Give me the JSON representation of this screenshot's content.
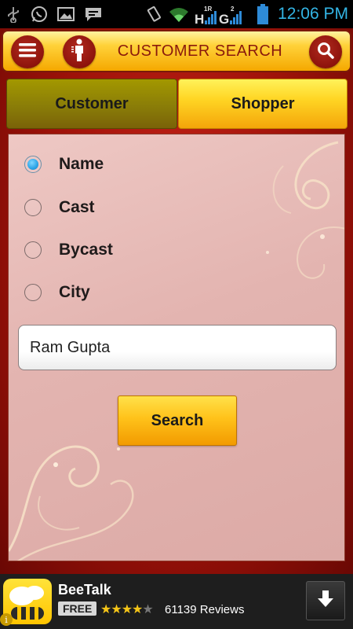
{
  "status_bar": {
    "time": "12:06 PM",
    "signal_labels": [
      "H",
      "1R",
      "G",
      "2"
    ],
    "icons": [
      "usb-icon",
      "whatsapp-icon",
      "gallery-icon",
      "chat-icon",
      "vibrate-icon",
      "wifi-icon",
      "signal-icon",
      "battery-icon"
    ]
  },
  "header": {
    "title": "CUSTOMER SEARCH",
    "menu_icon": "menu-icon",
    "person_icon": "person-icon",
    "search_icon": "search-icon"
  },
  "tabs": [
    {
      "label": "Customer",
      "selected": false
    },
    {
      "label": "Shopper",
      "selected": true
    }
  ],
  "search_by": {
    "options": [
      {
        "label": "Name",
        "checked": true
      },
      {
        "label": "Cast",
        "checked": false
      },
      {
        "label": "Bycast",
        "checked": false
      },
      {
        "label": "City",
        "checked": false
      }
    ],
    "input_value": "Ram Gupta",
    "button_label": "Search"
  },
  "ad": {
    "title": "BeeTalk",
    "badge": "FREE",
    "rating": 4,
    "rating_max": 5,
    "reviews": "61139 Reviews",
    "logo_icon": "beetalk-logo-icon",
    "download_icon": "download-arrow-icon",
    "info_icon": "info-icon"
  },
  "colors": {
    "header_title": "#8a1a0c",
    "radio_checked": "#2aa3e6",
    "status_text": "#33b5e5",
    "star": "#f5c518"
  }
}
